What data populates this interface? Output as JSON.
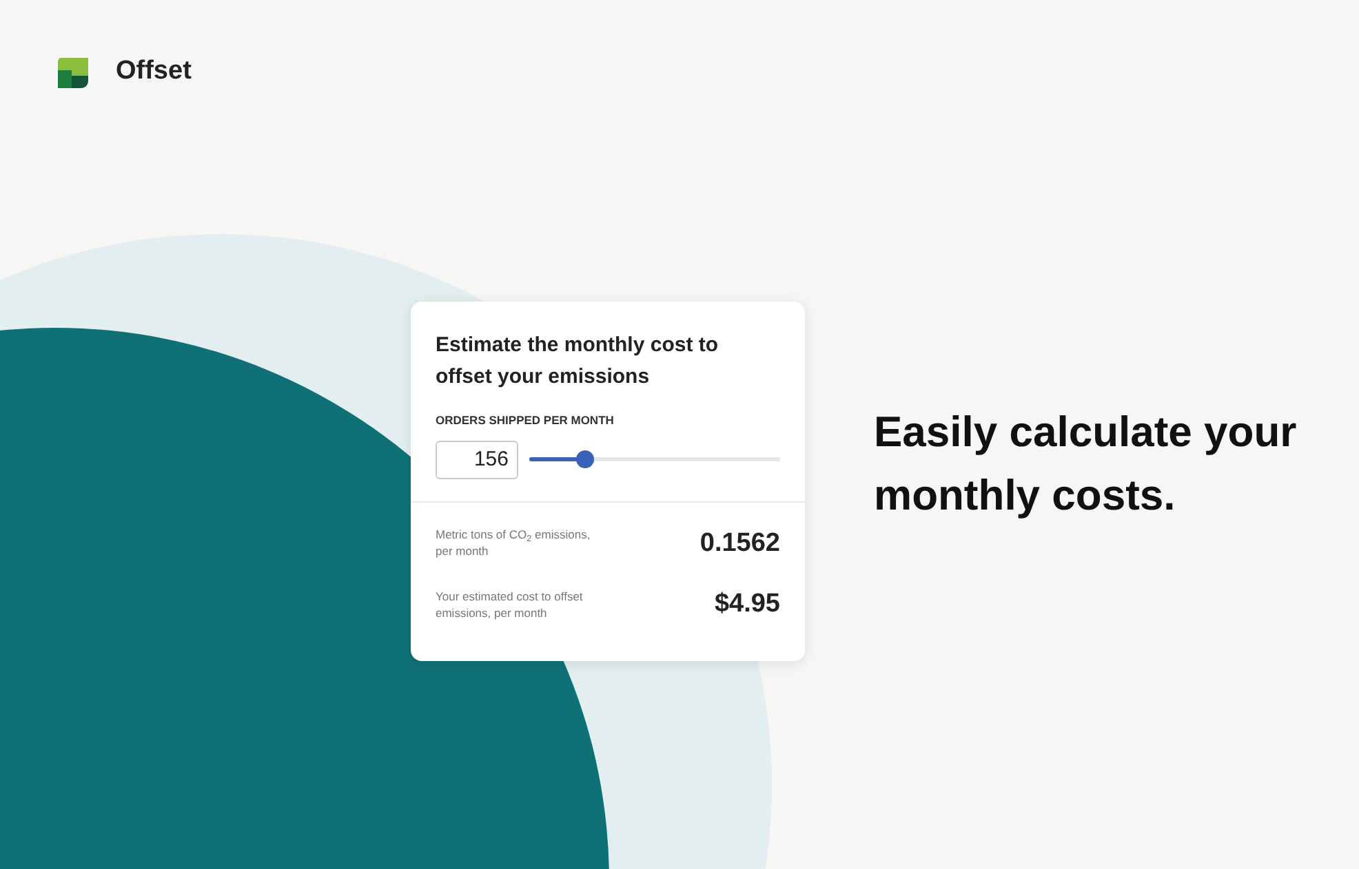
{
  "brand": {
    "name": "Offset"
  },
  "calculator": {
    "title": "Estimate the monthly cost to offset your emissions",
    "field_label": "ORDERS SHIPPED PER MONTH",
    "orders_value": "156",
    "slider": {
      "level": 0.22
    },
    "results": [
      {
        "label": "Metric tons of CO$_{2}$ emissions, per month",
        "value": "0.1562"
      },
      {
        "label": "Your estimated cost to offset emissions, per month",
        "value": "$4.95"
      }
    ]
  },
  "headline": "Easily calculate your monthly costs."
}
